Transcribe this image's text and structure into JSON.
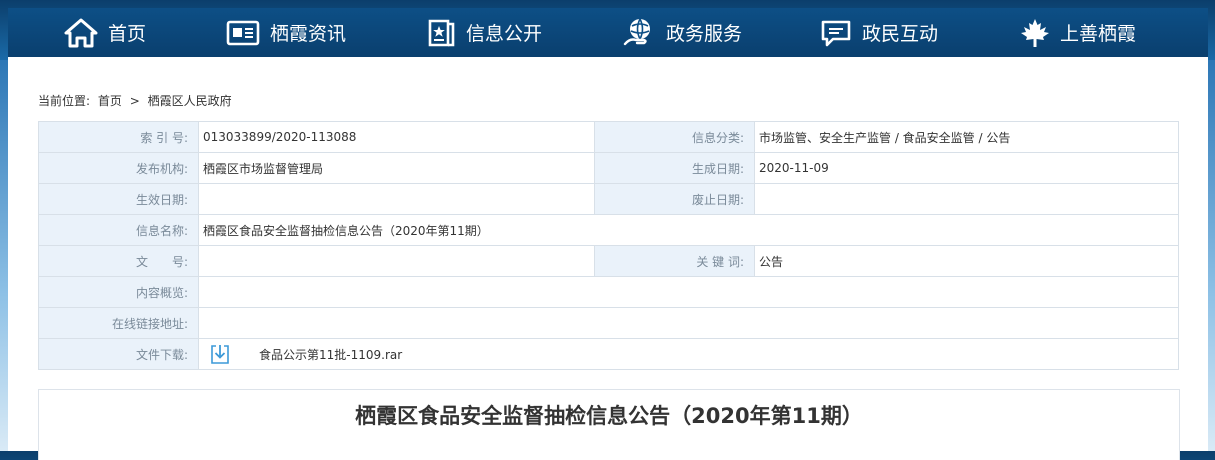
{
  "nav": {
    "items": [
      {
        "label": "首页",
        "icon": "home-icon"
      },
      {
        "label": "栖霞资讯",
        "icon": "news-icon"
      },
      {
        "label": "信息公开",
        "icon": "badge-book-icon"
      },
      {
        "label": "政务服务",
        "icon": "globe-hand-icon"
      },
      {
        "label": "政民互动",
        "icon": "chat-icon"
      },
      {
        "label": "上善栖霞",
        "icon": "maple-leaf-icon"
      }
    ]
  },
  "breadcrumb": {
    "prefix": "当前位置:",
    "home": "首页",
    "sep": ">",
    "current": "栖霞区人民政府"
  },
  "meta": {
    "index_no_label": "索 引 号:",
    "index_no": "013033899/2020-113088",
    "category_label": "信息分类:",
    "category": "市场监管、安全生产监管 / 食品安全监管 / 公告",
    "publisher_label": "发布机构:",
    "publisher": "栖霞区市场监督管理局",
    "created_label": "生成日期:",
    "created": "2020-11-09",
    "effective_label": "生效日期:",
    "effective": "",
    "expiry_label": "废止日期:",
    "expiry": "",
    "title_label": "信息名称:",
    "title": "栖霞区食品安全监督抽检信息公告（2020年第11期）",
    "doc_no_label": "文　　号:",
    "doc_no": "",
    "keywords_label": "关 键 词:",
    "keywords": "公告",
    "summary_label": "内容概览:",
    "summary": "",
    "online_link_label": "在线链接地址:",
    "online_link": "",
    "download_label": "文件下载:",
    "download_file": "食品公示第11批-1109.rar"
  },
  "article": {
    "title": "栖霞区食品安全监督抽检信息公告（2020年第11期）"
  },
  "colors": {
    "nav_bg": "#0d4f86",
    "label_bg": "#eaf2fa",
    "border": "#d8e0e8"
  }
}
